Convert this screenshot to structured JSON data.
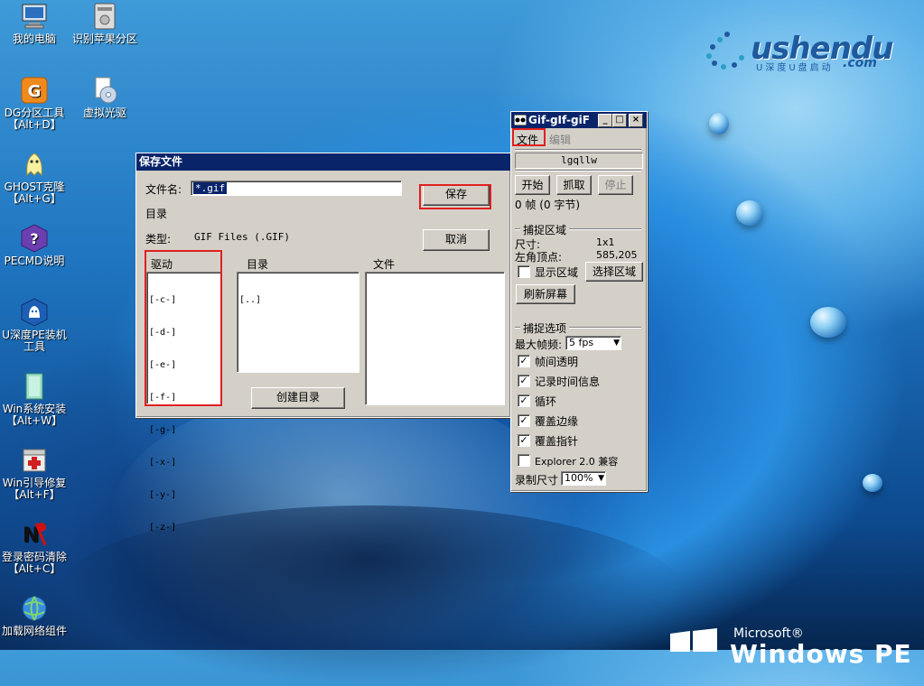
{
  "desktop_icons": [
    {
      "label": "我的电脑",
      "sub": "",
      "icon": "computer-icon"
    },
    {
      "label": "识别苹果分区",
      "sub": "",
      "icon": "disk-icon"
    },
    {
      "label": "DG分区工具",
      "sub": "【Alt+D】",
      "icon": "diskgenius-icon"
    },
    {
      "label": "虚拟光驱",
      "sub": "",
      "icon": "virtual-cd-icon"
    },
    {
      "label": "GHOST克隆",
      "sub": "【Alt+G】",
      "icon": "ghost-icon"
    },
    {
      "label": "PECMD说明",
      "sub": "",
      "icon": "help-icon"
    },
    {
      "label": "U深度PE装机",
      "sub": "工具",
      "icon": "installer-icon"
    },
    {
      "label": "Win系统安装",
      "sub": "【Alt+W】",
      "icon": "win-install-icon"
    },
    {
      "label": "Win引导修复",
      "sub": "【Alt+F】",
      "icon": "boot-repair-icon"
    },
    {
      "label": "登录密码清除",
      "sub": "【Alt+C】",
      "icon": "password-clear-icon"
    },
    {
      "label": "加载网络组件",
      "sub": "",
      "icon": "network-icon"
    }
  ],
  "logo": {
    "brand": "ushendu",
    "tagline": "U深度U盘启动",
    "suffix": ".com"
  },
  "winlogo": {
    "microsoft": "Microsoft®",
    "product": "Windows PE"
  },
  "save_dialog": {
    "title": "保存文件",
    "filename_label": "文件名:",
    "filename_value": "*.gif",
    "dir_label": "目录",
    "type_label": "类型:",
    "type_value": "GIF Files (.GIF)",
    "save_button": "保存",
    "cancel_button": "取消",
    "drives_header": "驱动",
    "dirs_header": "目录",
    "files_header": "文件",
    "drives": [
      "[-c-]",
      "[-d-]",
      "[-e-]",
      "[-f-]",
      "[-g-]",
      "[-x-]",
      "[-y-]",
      "[-z-]"
    ],
    "dirs": [
      "[..]"
    ],
    "create_dir_button": "创建目录"
  },
  "gif_tool": {
    "title": "Gif-gIf-giF",
    "menu_file": "文件",
    "menu_edit": "编辑",
    "status": "lgqllw",
    "start_button": "开始",
    "grab_button": "抓取",
    "stop_button": "停止",
    "frames_info": "0 帧 (0 字节)",
    "capture_area_header": "捕捉区域",
    "size_label": "尺寸:",
    "size_value": "1x1",
    "corner_label": "左角顶点:",
    "corner_value": "585,205",
    "show_area_label": "显示区域",
    "select_area_button": "选择区域",
    "refresh_button": "刷新屏幕",
    "capture_options_header": "捕捉选项",
    "max_fps_label": "最大帧频:",
    "max_fps_value": "5 fps",
    "options": [
      {
        "label": "帧间透明",
        "checked": true
      },
      {
        "label": "记录时间信息",
        "checked": true
      },
      {
        "label": "循环",
        "checked": true
      },
      {
        "label": "覆盖边缘",
        "checked": true
      },
      {
        "label": "覆盖指针",
        "checked": true
      },
      {
        "label": "Explorer 2.0 兼容",
        "checked": false
      }
    ],
    "record_size_label": "录制尺寸",
    "record_size_value": "100%"
  }
}
